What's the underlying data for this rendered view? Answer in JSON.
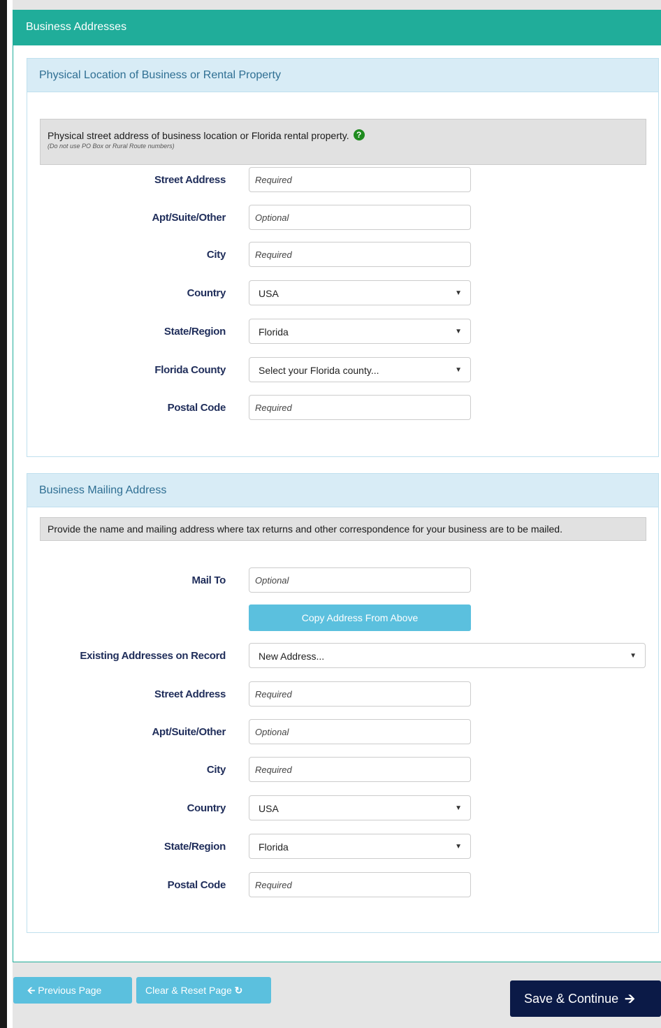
{
  "page": {
    "title": "Business Addresses"
  },
  "physical": {
    "title": "Physical Location of Business or Rental Property",
    "info": "Physical street address of business location or Florida rental property.",
    "info_note": "(Do not use PO Box or Rural Route numbers)",
    "help_icon": "?",
    "street_label": "Street Address",
    "street_placeholder": "Required",
    "apt_label": "Apt/Suite/Other",
    "apt_placeholder": "Optional",
    "city_label": "City",
    "city_placeholder": "Required",
    "country_label": "Country",
    "country_value": "USA",
    "state_label": "State/Region",
    "state_value": "Florida",
    "county_label": "Florida County",
    "county_value": "Select your Florida county...",
    "postal_label": "Postal Code",
    "postal_placeholder": "Required"
  },
  "mailing": {
    "title": "Business Mailing Address",
    "info": "Provide the name and mailing address where tax returns and other correspondence for your business are to be mailed.",
    "mailto_label": "Mail To",
    "mailto_placeholder": "Optional",
    "copy_button": "Copy Address From Above",
    "existing_label": "Existing Addresses on Record",
    "existing_value": "New Address...",
    "street_label": "Street Address",
    "street_placeholder": "Required",
    "apt_label": "Apt/Suite/Other",
    "apt_placeholder": "Optional",
    "city_label": "City",
    "city_placeholder": "Required",
    "country_label": "Country",
    "country_value": "USA",
    "state_label": "State/Region",
    "state_value": "Florida",
    "postal_label": "Postal Code",
    "postal_placeholder": "Required"
  },
  "footer": {
    "previous": "Previous Page",
    "clear": "Clear & Reset Page",
    "save": "Save & Continue"
  },
  "colors": {
    "header_teal": "#20ad9a",
    "subheader_bg": "#d8ecf6",
    "button_blue": "#5bc0de",
    "save_navy": "#0b1a47",
    "label_navy": "#1f2d5a"
  },
  "icons": {
    "help": "question-circle-icon",
    "dropdown": "caret-down-icon",
    "previous": "arrow-left-icon",
    "clear": "refresh-icon",
    "save": "arrow-right-icon"
  }
}
